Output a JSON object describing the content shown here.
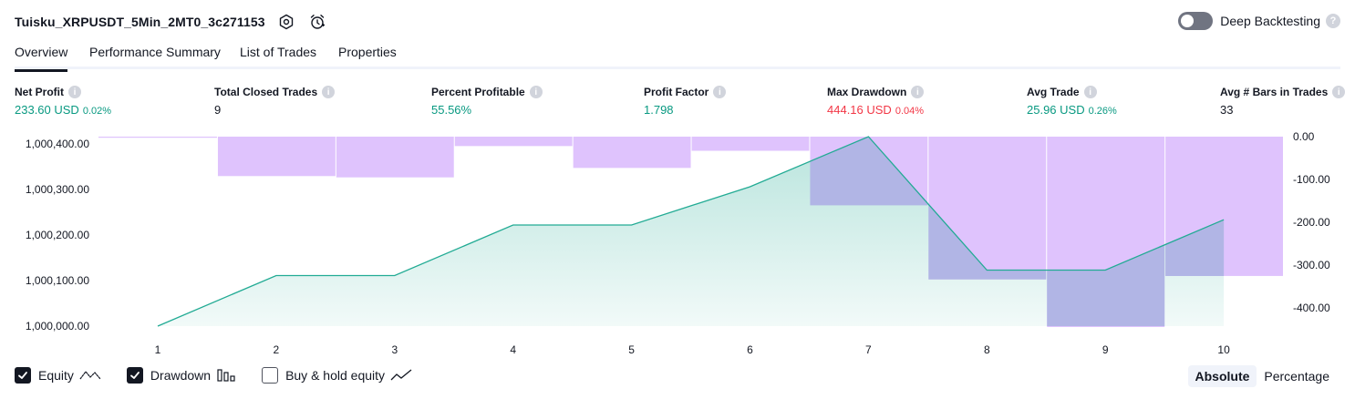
{
  "header": {
    "title": "Tuisku_XRPUSDT_5Min_2MT0_3c271153",
    "deep_backtesting_label": "Deep Backtesting",
    "deep_backtesting_on": false
  },
  "tabs": [
    {
      "label": "Overview",
      "active": true
    },
    {
      "label": "Performance Summary",
      "active": false
    },
    {
      "label": "List of Trades",
      "active": false
    },
    {
      "label": "Properties",
      "active": false
    }
  ],
  "metrics": [
    {
      "label": "Net Profit",
      "value": "233.60 USD",
      "pct": "0.02%",
      "tone": "pos"
    },
    {
      "label": "Total Closed Trades",
      "value": "9",
      "pct": "",
      "tone": "neu"
    },
    {
      "label": "Percent Profitable",
      "value": "55.56%",
      "pct": "",
      "tone": "pos"
    },
    {
      "label": "Profit Factor",
      "value": "1.798",
      "pct": "",
      "tone": "pos"
    },
    {
      "label": "Max Drawdown",
      "value": "444.16 USD",
      "pct": "0.04%",
      "tone": "neg"
    },
    {
      "label": "Avg Trade",
      "value": "25.96 USD",
      "pct": "0.26%",
      "tone": "pos"
    },
    {
      "label": "Avg # Bars in Trades",
      "value": "33",
      "pct": "",
      "tone": "neu"
    }
  ],
  "chart_data": {
    "type": "area",
    "x": [
      1,
      2,
      3,
      4,
      5,
      6,
      7,
      8,
      9,
      10
    ],
    "x_tick_labels": [
      "1",
      "2",
      "3",
      "4",
      "5",
      "6",
      "7",
      "8",
      "9",
      "10"
    ],
    "series": [
      {
        "name": "Equity",
        "axis": "left",
        "type": "area",
        "values": [
          1000000,
          1000111,
          1000111,
          1000222,
          1000222,
          1000306,
          1000416,
          1000123,
          1000123,
          1000233.6
        ]
      },
      {
        "name": "Drawdown",
        "axis": "right",
        "type": "bar",
        "values": [
          0,
          -92,
          -95,
          -22,
          -73,
          -33,
          -160,
          -333,
          -444.16,
          -325
        ]
      }
    ],
    "left_axis": {
      "ylim": [
        1000000,
        1000416
      ],
      "tick_labels": [
        "1,000,400.00",
        "1,000,300.00",
        "1,000,200.00",
        "1,000,100.00",
        "1,000,000.00"
      ],
      "ticks": [
        1000400,
        1000300,
        1000200,
        1000100,
        1000000
      ]
    },
    "right_axis": {
      "ylim": [
        -444.16,
        0
      ],
      "tick_labels": [
        "0.00",
        "-100.00",
        "-200.00",
        "-300.00",
        "-400.00"
      ],
      "ticks": [
        0,
        -100,
        -200,
        -300,
        -400
      ]
    },
    "colors": {
      "equity_line": "#22ab94",
      "equity_fill": "#22ab94",
      "drawdown_fill": "#dfc3fd",
      "drawdown_overlap": "#b1b5e5"
    }
  },
  "legend": [
    {
      "label": "Equity",
      "checked": true,
      "icon": "equity-line-icon"
    },
    {
      "label": "Drawdown",
      "checked": true,
      "icon": "drawdown-bars-icon"
    },
    {
      "label": "Buy & hold equity",
      "checked": false,
      "icon": "buy-hold-line-icon"
    }
  ],
  "view_mode": {
    "options": [
      "Absolute",
      "Percentage"
    ],
    "selected": "Absolute"
  }
}
